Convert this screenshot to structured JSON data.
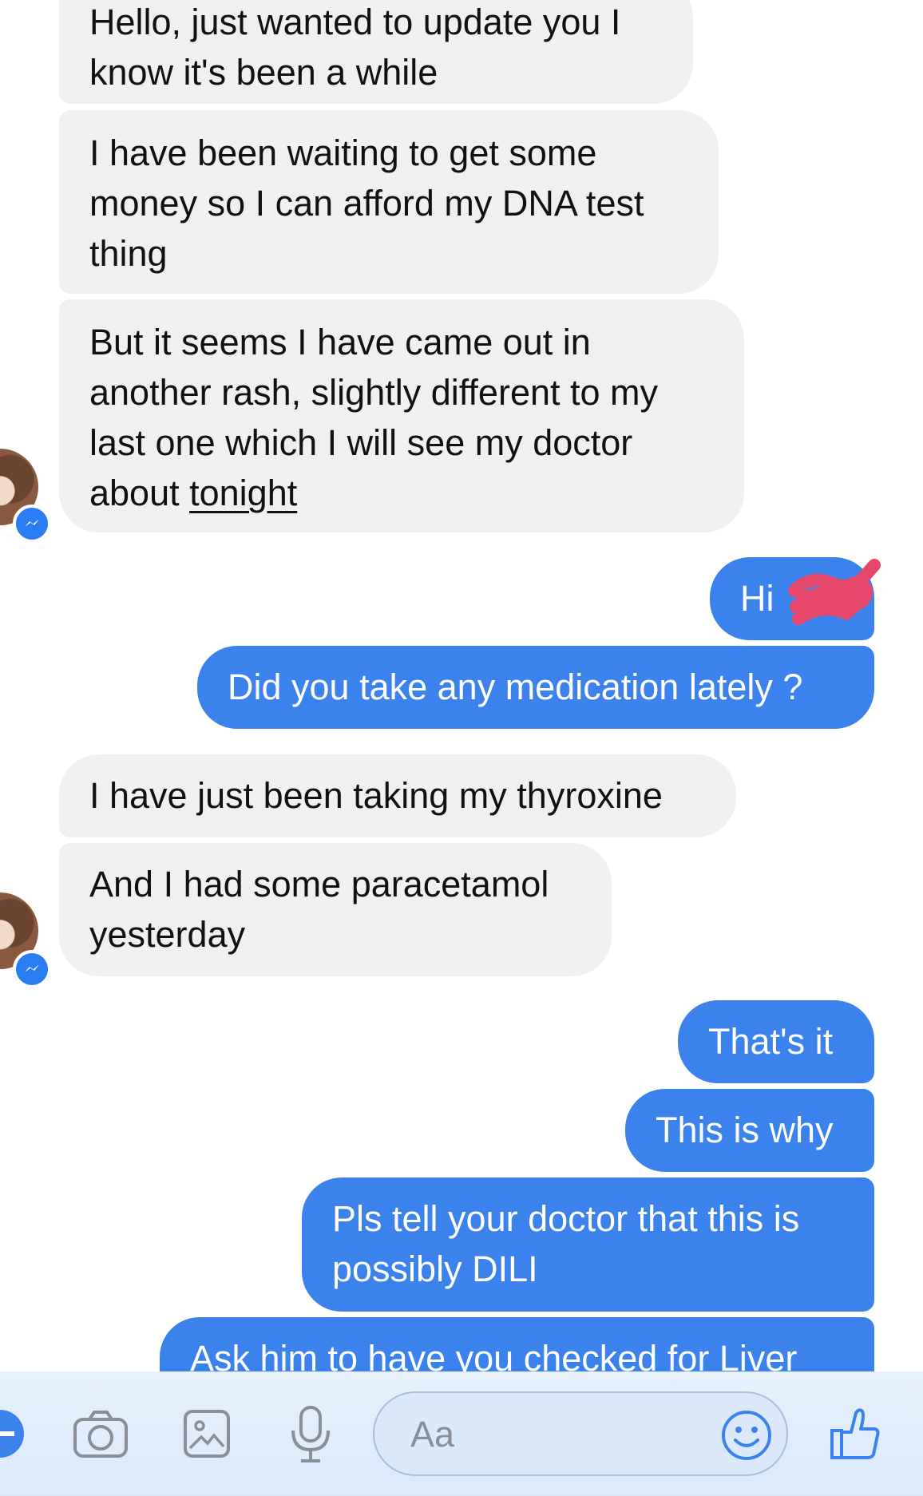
{
  "messages": [
    {
      "side": "in",
      "lines": [
        "Hello, just wanted to update you I",
        "know it's been a while"
      ]
    },
    {
      "side": "in",
      "lines": [
        "I have been waiting to get some",
        "money so I can afford my DNA test",
        "thing"
      ]
    },
    {
      "side": "in",
      "lines": [
        "But it seems I have came out in",
        "another rash, slightly different to my",
        "last one which I will see my doctor"
      ],
      "last_prefix": "about ",
      "last_link": "tonight"
    },
    {
      "side": "out",
      "text": "Hi "
    },
    {
      "side": "out",
      "text": "Did you take any medication lately ?"
    },
    {
      "side": "in",
      "lines": [
        "I have just been taking my thyroxine"
      ]
    },
    {
      "side": "in",
      "lines": [
        "And I had some paracetamol",
        "yesterday"
      ]
    },
    {
      "side": "out",
      "text": "That's it"
    },
    {
      "side": "out",
      "text": "This is why"
    },
    {
      "side": "out",
      "lines": [
        "Pls tell your doctor that this is",
        "possibly DILI"
      ]
    },
    {
      "side": "out",
      "text": "Ask him to have you checked for Liver"
    }
  ],
  "composer": {
    "placeholder": "Aa",
    "icons": [
      "plus-icon",
      "camera-icon",
      "gallery-icon",
      "microphone-icon",
      "emoji-icon",
      "thumbs-up-icon"
    ]
  },
  "colors": {
    "outgoing": "#3b82ec",
    "incoming": "#f0f0f0",
    "redaction": "#e8476c"
  }
}
